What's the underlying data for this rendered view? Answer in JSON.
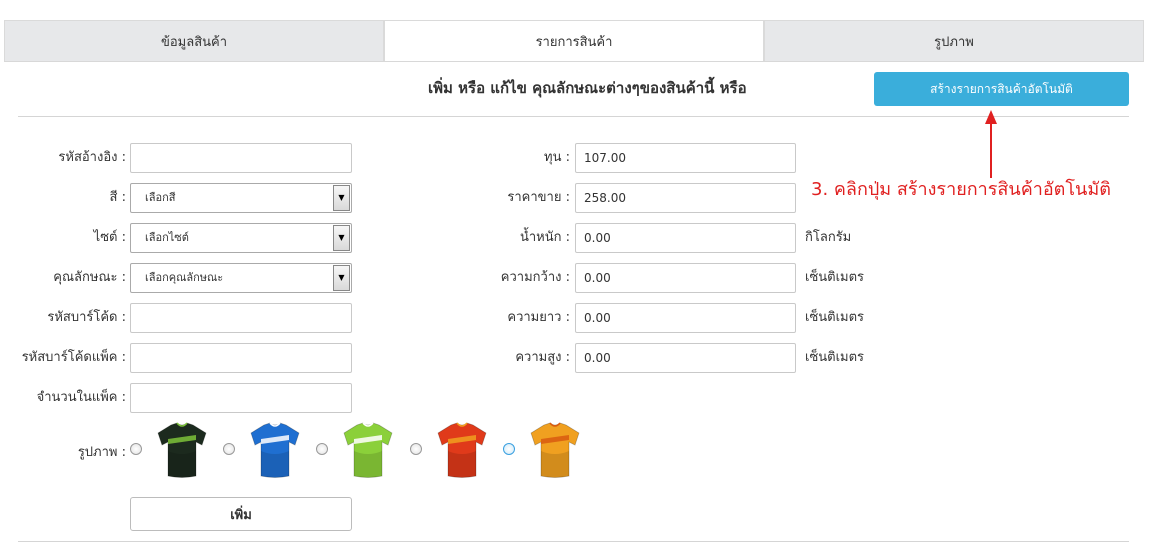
{
  "tabs": [
    {
      "label": "ข้อมูลสินค้า"
    },
    {
      "label": "รายการสินค้า"
    },
    {
      "label": "รูปภาพ"
    }
  ],
  "active_tab": 1,
  "header": {
    "title": "เพิ่ม หรือ แก้ไข คุณลักษณะต่างๆของสินค้านี้ หรือ",
    "auto_button": "สร้างรายการสินค้าอัตโนมัติ"
  },
  "left_form": {
    "ref_code": {
      "label": "รหัสอ้างอิง :",
      "value": ""
    },
    "color": {
      "label": "สี :",
      "value": "เลือกสี"
    },
    "size": {
      "label": "ไซต์ :",
      "value": "เลือกไซต์"
    },
    "attribute": {
      "label": "คุณลักษณะ :",
      "value": "เลือกคุณลักษณะ"
    },
    "barcode": {
      "label": "รหัสบาร์โค้ด :",
      "value": ""
    },
    "pack_barcode": {
      "label": "รหัสบาร์โค้ดแพ็ค :",
      "value": ""
    },
    "pack_qty": {
      "label": "จำนวนในแพ็ค :",
      "value": ""
    }
  },
  "right_form": {
    "cost": {
      "label": "ทุน :",
      "value": "107.00"
    },
    "price": {
      "label": "ราคาขาย :",
      "value": "258.00"
    },
    "weight": {
      "label": "น้ำหนัก :",
      "value": "0.00",
      "unit": "กิโลกรัม"
    },
    "width": {
      "label": "ความกว้าง :",
      "value": "0.00",
      "unit": "เซ็นติเมตร"
    },
    "length": {
      "label": "ความยาว :",
      "value": "0.00",
      "unit": "เซ็นติเมตร"
    },
    "height": {
      "label": "ความสูง :",
      "value": "0.00",
      "unit": "เซ็นติเมตร"
    }
  },
  "images": {
    "label": "รูปภาพ :",
    "selected_index": 4,
    "items": [
      {
        "icon": "jersey-black-green-icon",
        "primary": "#1c2a1e",
        "accent": "#7cc23a"
      },
      {
        "icon": "jersey-blue-icon",
        "primary": "#1f6fd1",
        "accent": "#ffffff"
      },
      {
        "icon": "jersey-lime-icon",
        "primary": "#8bd03a",
        "accent": "#ffffff"
      },
      {
        "icon": "jersey-red-icon",
        "primary": "#e03a1a",
        "accent": "#f0a020"
      },
      {
        "icon": "jersey-orange-icon",
        "primary": "#f0a020",
        "accent": "#d85a10"
      }
    ]
  },
  "add_button": "เพิ่ม",
  "annotation": {
    "text": "3. คลิกปุ่ม สร้างรายการสินค้าอัตโนมัติ",
    "color": "#e02020"
  }
}
